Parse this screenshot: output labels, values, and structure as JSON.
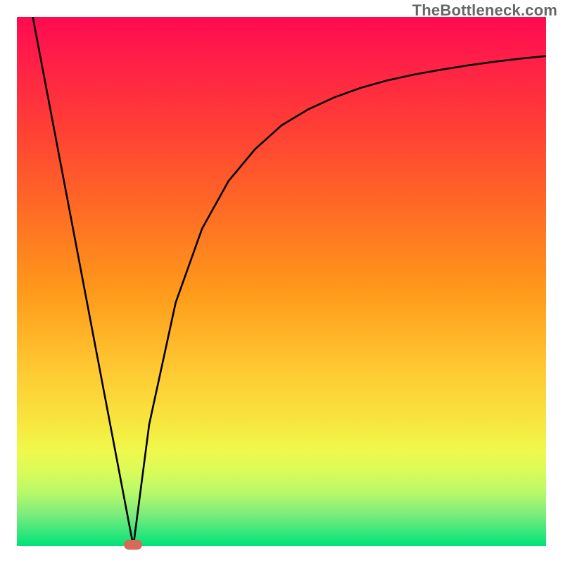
{
  "watermark": "TheBottleneck.com",
  "colors": {
    "frame": "#000000",
    "curve": "#000000",
    "marker": "#d56a5a",
    "gradient_top": "#ff0a50",
    "gradient_bottom": "#00e27a"
  },
  "chart_data": {
    "type": "line",
    "title": "",
    "xlabel": "",
    "ylabel": "",
    "xlim": [
      0,
      100
    ],
    "ylim": [
      0,
      100
    ],
    "grid": false,
    "legend": false,
    "series": [
      {
        "name": "left-segment",
        "x": [
          3,
          22
        ],
        "values": [
          100,
          0
        ]
      },
      {
        "name": "right-segment",
        "x": [
          22,
          25,
          30,
          35,
          40,
          45,
          50,
          55,
          60,
          65,
          70,
          75,
          80,
          85,
          90,
          95,
          100
        ],
        "values": [
          0,
          23,
          46,
          60,
          69,
          75,
          79.5,
          82.5,
          84.8,
          86.6,
          88,
          89.1,
          90,
          90.8,
          91.5,
          92.1,
          92.6
        ]
      }
    ],
    "annotations": [
      {
        "name": "minimum-marker",
        "x": 22,
        "y": 0
      }
    ]
  }
}
